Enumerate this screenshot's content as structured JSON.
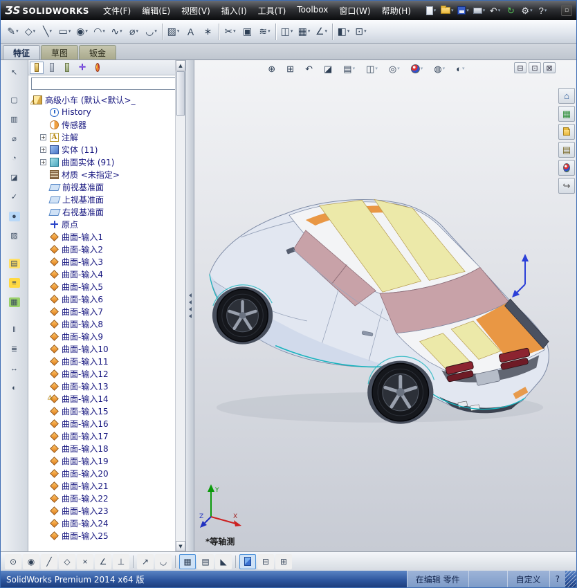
{
  "titlebar": {
    "logo_mark": "ƷS",
    "logo_text": "SOLIDWORKS",
    "menus": [
      {
        "id": "file",
        "label": "文件(F)"
      },
      {
        "id": "edit",
        "label": "编辑(E)"
      },
      {
        "id": "view",
        "label": "视图(V)"
      },
      {
        "id": "insert",
        "label": "插入(I)"
      },
      {
        "id": "tools",
        "label": "工具(T)"
      },
      {
        "id": "toolbox",
        "label": "Toolbox"
      },
      {
        "id": "window",
        "label": "窗口(W)"
      },
      {
        "id": "help",
        "label": "帮助(H)"
      }
    ],
    "quick_icons": [
      {
        "id": "new-document",
        "kind": "page",
        "dd": true
      },
      {
        "id": "open-document",
        "kind": "folder",
        "dd": true
      },
      {
        "id": "save-document",
        "kind": "floppy",
        "dd": true
      },
      {
        "id": "print-document",
        "kind": "print",
        "dd": true
      },
      {
        "id": "undo",
        "glyph": "↶",
        "dd": true
      },
      {
        "id": "rebuild",
        "glyph": "↻",
        "color": "#58c858",
        "dd": false
      },
      {
        "id": "options",
        "glyph": "⚙",
        "dd": true
      },
      {
        "id": "help",
        "glyph": "?",
        "dd": true
      }
    ],
    "overflow_glyph": "▫"
  },
  "toolbar": {
    "buttons": [
      {
        "id": "sketch",
        "glyph": "✎",
        "dd": true
      },
      {
        "id": "smart-dimension",
        "glyph": "◇",
        "dd": true
      },
      {
        "id": "line",
        "glyph": "╲",
        "dd": true
      },
      {
        "id": "rectangle",
        "glyph": "▭",
        "dd": true
      },
      {
        "id": "circle",
        "glyph": "◉",
        "dd": true
      },
      {
        "id": "arc",
        "glyph": "◠",
        "dd": true
      },
      {
        "id": "spline",
        "glyph": "∿",
        "dd": true
      },
      {
        "id": "ellipse",
        "glyph": "⌀",
        "dd": true
      },
      {
        "id": "sketch-fillet",
        "glyph": "◡",
        "dd": true
      },
      {
        "sep": true
      },
      {
        "id": "hatch",
        "glyph": "▨",
        "dd": true
      },
      {
        "id": "sketch-text",
        "glyph": "A",
        "dd": false
      },
      {
        "id": "point",
        "glyph": "∗",
        "dd": false
      },
      {
        "sep": true
      },
      {
        "id": "trim-entities",
        "glyph": "✂",
        "dd": true
      },
      {
        "id": "convert-entities",
        "glyph": "▣",
        "dd": false
      },
      {
        "id": "offset-entities",
        "glyph": "≋",
        "dd": true
      },
      {
        "sep": true
      },
      {
        "id": "mirror-entities",
        "glyph": "◫",
        "dd": true
      },
      {
        "id": "linear-pattern",
        "glyph": "▦",
        "dd": true
      },
      {
        "id": "display-relations",
        "glyph": "∠",
        "dd": true
      },
      {
        "sep": true
      },
      {
        "id": "reference-plane",
        "glyph": "◧",
        "dd": true
      },
      {
        "id": "instant3d",
        "glyph": "⊡",
        "dd": true
      }
    ]
  },
  "tabs": {
    "items": [
      {
        "id": "features",
        "label": "特征",
        "active": true
      },
      {
        "id": "sketch",
        "label": "草图",
        "active": false
      },
      {
        "id": "sheet-metal",
        "label": "钣金",
        "active": false
      }
    ]
  },
  "left_toolbar": {
    "buttons": [
      {
        "id": "select",
        "glyph": "↖"
      },
      {
        "id": "box-select",
        "glyph": "▢",
        "gap": true
      },
      {
        "id": "selection-filter",
        "glyph": "▥"
      },
      {
        "id": "measure",
        "glyph": "⌀"
      },
      {
        "id": "mass-properties",
        "glyph": "◔"
      },
      {
        "id": "section-properties",
        "glyph": "◪"
      },
      {
        "id": "check-entity",
        "glyph": "✓"
      },
      {
        "id": "appearance",
        "glyph": "●",
        "tint": "#b8d8f8"
      },
      {
        "id": "texture",
        "glyph": "▨"
      },
      {
        "id": "layer-properties",
        "glyph": "▤",
        "tint": "#ffe066",
        "gap": true
      },
      {
        "id": "line-format",
        "glyph": "≡",
        "tint": "#ffd942"
      },
      {
        "id": "grid-settings",
        "glyph": "▦",
        "tint": "#9ad06a"
      },
      {
        "id": "align",
        "glyph": "‖",
        "gap": true
      },
      {
        "id": "distribute",
        "glyph": "≣"
      },
      {
        "id": "move-entity",
        "glyph": "↔"
      },
      {
        "id": "show-hide",
        "glyph": "◐"
      }
    ]
  },
  "tree_panel": {
    "panel_tabs": [
      {
        "id": "featuremanager",
        "kind": "feature",
        "active": true
      },
      {
        "id": "propertymanager",
        "kind": "property",
        "active": false
      },
      {
        "id": "configurationmanager",
        "kind": "config",
        "active": false
      },
      {
        "id": "dimxpertmanager",
        "kind": "dimxpert",
        "glyph": "✛",
        "active": false
      },
      {
        "id": "displaymanager",
        "kind": "display",
        "active": false
      }
    ],
    "overflow_label": "»",
    "filter_value": "",
    "items": [
      {
        "label": "高级小车 (默认<默认>_",
        "icon": "part",
        "level": 0,
        "warning": true
      },
      {
        "label": "History",
        "icon": "history",
        "level": 1
      },
      {
        "label": "传感器",
        "icon": "sensors",
        "level": 1
      },
      {
        "label": "注解",
        "icon": "annotations",
        "level": 1,
        "expand": "+"
      },
      {
        "label": "实体 (11)",
        "icon": "solids",
        "level": 1,
        "expand": "+"
      },
      {
        "label": "曲面实体 (91)",
        "icon": "surfaces",
        "level": 1,
        "expand": "+"
      },
      {
        "label": "材质 <未指定>",
        "icon": "material",
        "level": 1
      },
      {
        "label": "前视基准面",
        "icon": "plane",
        "level": 1
      },
      {
        "label": "上视基准面",
        "icon": "plane",
        "level": 1
      },
      {
        "label": "右视基准面",
        "icon": "plane",
        "level": 1
      },
      {
        "label": "原点",
        "icon": "origin",
        "level": 1
      },
      {
        "label": "曲面-输入1",
        "icon": "surface",
        "level": 1
      },
      {
        "label": "曲面-输入2",
        "icon": "surface",
        "level": 1
      },
      {
        "label": "曲面-输入3",
        "icon": "surface",
        "level": 1
      },
      {
        "label": "曲面-输入4",
        "icon": "surface",
        "level": 1
      },
      {
        "label": "曲面-输入5",
        "icon": "surface",
        "level": 1
      },
      {
        "label": "曲面-输入6",
        "icon": "surface",
        "level": 1
      },
      {
        "label": "曲面-输入7",
        "icon": "surface",
        "level": 1
      },
      {
        "label": "曲面-输入8",
        "icon": "surface",
        "level": 1
      },
      {
        "label": "曲面-输入9",
        "icon": "surface",
        "level": 1
      },
      {
        "label": "曲面-输入10",
        "icon": "surface",
        "level": 1
      },
      {
        "label": "曲面-输入11",
        "icon": "surface",
        "level": 1
      },
      {
        "label": "曲面-输入12",
        "icon": "surface",
        "level": 1
      },
      {
        "label": "曲面-输入13",
        "icon": "surface",
        "level": 1
      },
      {
        "label": "曲面-输入14",
        "icon": "surface",
        "level": 1,
        "warning": true
      },
      {
        "label": "曲面-输入15",
        "icon": "surface",
        "level": 1
      },
      {
        "label": "曲面-输入16",
        "icon": "surface",
        "level": 1
      },
      {
        "label": "曲面-输入17",
        "icon": "surface",
        "level": 1
      },
      {
        "label": "曲面-输入18",
        "icon": "surface",
        "level": 1
      },
      {
        "label": "曲面-输入19",
        "icon": "surface",
        "level": 1
      },
      {
        "label": "曲面-输入20",
        "icon": "surface",
        "level": 1
      },
      {
        "label": "曲面-输入21",
        "icon": "surface",
        "level": 1
      },
      {
        "label": "曲面-输入22",
        "icon": "surface",
        "level": 1
      },
      {
        "label": "曲面-输入23",
        "icon": "surface",
        "level": 1
      },
      {
        "label": "曲面-输入24",
        "icon": "surface",
        "level": 1
      },
      {
        "label": "曲面-输入25",
        "icon": "surface",
        "level": 1
      }
    ]
  },
  "viewport": {
    "hud_buttons": [
      {
        "id": "zoom-fit",
        "glyph": "⊕"
      },
      {
        "id": "zoom-area",
        "glyph": "⊞"
      },
      {
        "id": "previous-view",
        "glyph": "↶"
      },
      {
        "id": "section-view",
        "glyph": "◪"
      },
      {
        "id": "view-orientation",
        "glyph": "▤",
        "dd": true
      },
      {
        "id": "display-style",
        "glyph": "◫",
        "dd": true
      },
      {
        "id": "hide-show-items",
        "glyph": "◎",
        "dd": true
      },
      {
        "id": "edit-appearance",
        "ball": true,
        "dd": true
      },
      {
        "id": "apply-scene",
        "glyph": "◍",
        "dd": true
      },
      {
        "id": "view-settings",
        "glyph": "◐",
        "dd": true
      }
    ],
    "window_controls": [
      {
        "id": "minimize-document",
        "glyph": "⊟"
      },
      {
        "id": "restore-document",
        "glyph": "⊡"
      },
      {
        "id": "close-document",
        "glyph": "⊠"
      }
    ],
    "task_pane": [
      {
        "id": "solidworks-resources",
        "glyph": "⌂",
        "color": "#2a5a9a"
      },
      {
        "id": "design-library",
        "glyph": "▦",
        "color": "#2f8f3a"
      },
      {
        "id": "file-explorer",
        "folder": true
      },
      {
        "id": "view-palette",
        "glyph": "▤",
        "color": "#7a6a2a"
      },
      {
        "id": "appearances-scenes",
        "ball": true
      },
      {
        "id": "custom-properties",
        "glyph": "↪",
        "color": "#555555"
      }
    ],
    "orientation_label": "*等轴测",
    "triad": {
      "x": "X",
      "y": "Y",
      "z": "Z"
    }
  },
  "palette": {
    "body": "#e2e7f1",
    "body_shade": "#c3cfe6",
    "roof": "#f3f4f6",
    "stripe": "#ece9a9",
    "stripe_edge": "#b59a4e",
    "glass": "#c8a2a8",
    "accent": "#e8913a",
    "trim": "#17b3bd",
    "tire": "#15171c",
    "rim": "#8f96a4",
    "light": "#8c2430",
    "edge": "#7e8ba6"
  },
  "bottom_toolbar": {
    "buttons": [
      {
        "id": "snap-points",
        "glyph": "⊙"
      },
      {
        "id": "snap-center",
        "glyph": "◉"
      },
      {
        "id": "snap-line",
        "glyph": "╱"
      },
      {
        "id": "snap-midpoint",
        "glyph": "◇"
      },
      {
        "id": "snap-intersection",
        "glyph": "×"
      },
      {
        "id": "snap-angle",
        "glyph": "∠"
      },
      {
        "id": "snap-perpendicular",
        "glyph": "⊥"
      },
      {
        "sep": true
      },
      {
        "id": "quick-snaps",
        "glyph": "↗"
      },
      {
        "id": "snap-tangent",
        "glyph": "◡"
      },
      {
        "sep": true
      },
      {
        "id": "sketch-settings",
        "glyph": "▦",
        "pressed": true
      },
      {
        "id": "grid",
        "glyph": "▤"
      },
      {
        "id": "snap-grid",
        "glyph": "◣"
      },
      {
        "sep": true
      },
      {
        "id": "shaded-with-edges",
        "cube": true,
        "pressed": true
      },
      {
        "id": "viewport-split-two",
        "glyph": "⊟"
      },
      {
        "id": "viewport-split-four",
        "glyph": "⊞"
      }
    ]
  },
  "statusbar": {
    "left": "SolidWorks Premium 2014 x64 版",
    "edit_mode": "在编辑 零件",
    "blank": "",
    "custom": "自定义",
    "tip_glyph": "?"
  }
}
